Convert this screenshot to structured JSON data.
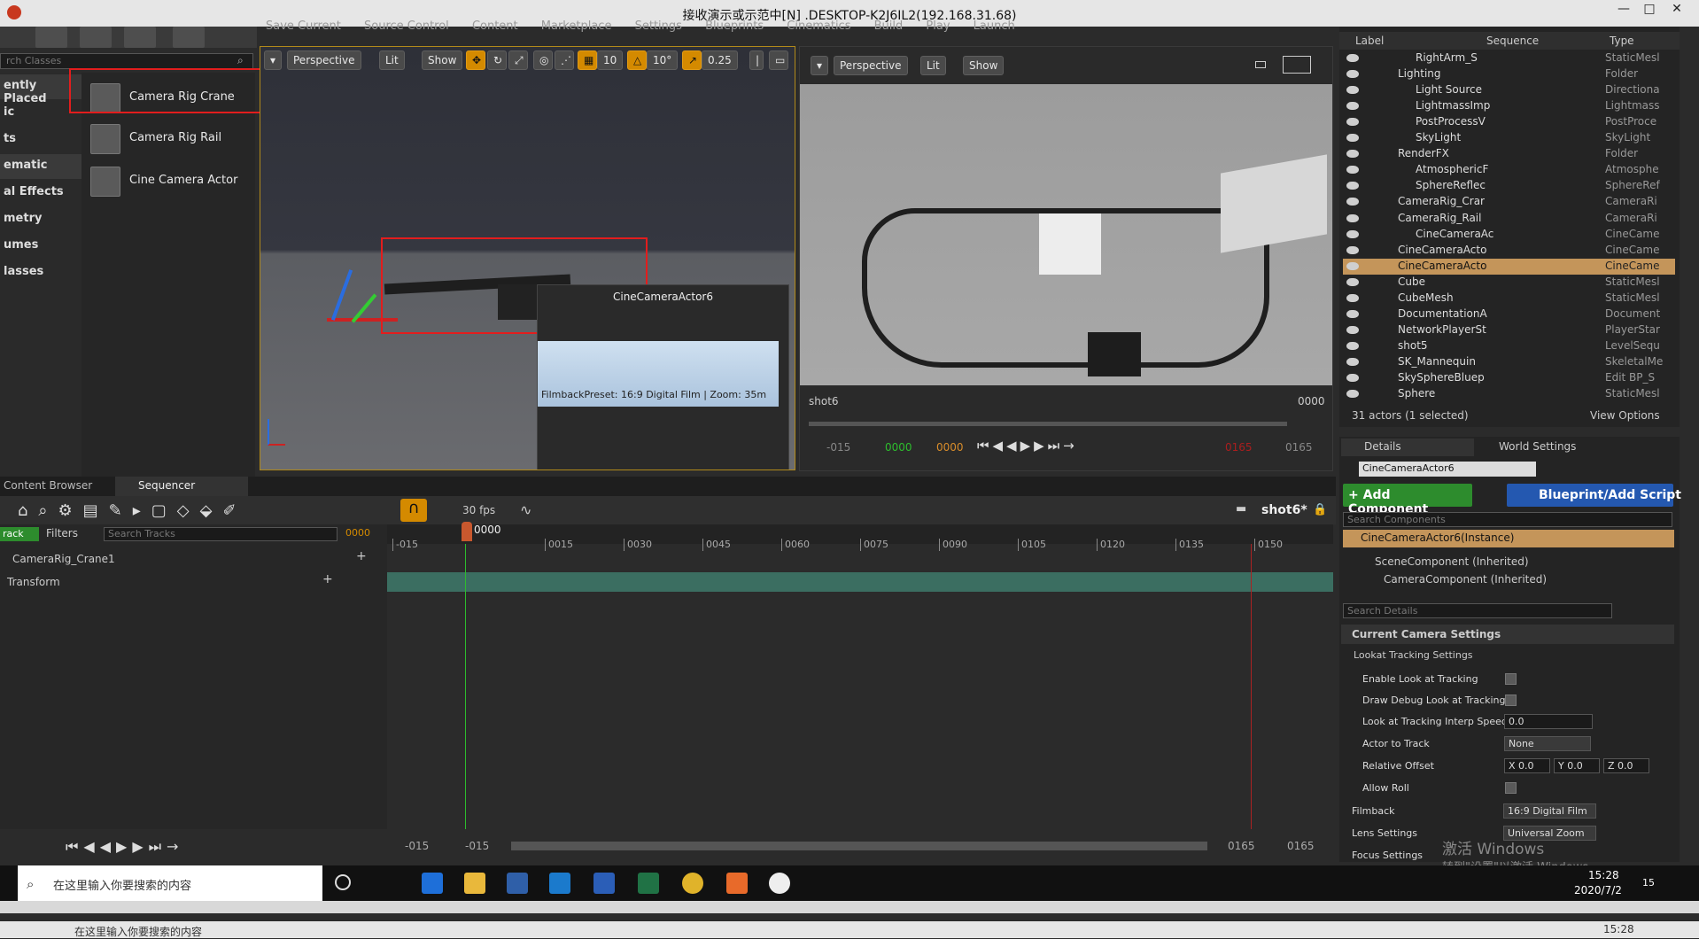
{
  "window": {
    "title": "接收演示或示范中[N] .DESKTOP-K2J6IL2(192.168.31.68)"
  },
  "menu": [
    "Save Current",
    "Source Control",
    "Content",
    "Marketplace",
    "Settings",
    "Blueprints",
    "Cinematics",
    "Build",
    "Play",
    "Launch"
  ],
  "place": {
    "search_placeholder": "rch Classes",
    "categories": [
      "ently Placed",
      "ic",
      "ts",
      "ematic",
      "al Effects",
      "metry",
      "umes",
      "lasses"
    ],
    "items": [
      "Camera Rig Crane",
      "Camera Rig Rail",
      "Cine Camera Actor"
    ]
  },
  "viewport_left": {
    "perspective": "Perspective",
    "lit": "Lit",
    "show": "Show",
    "grid_snap": "10",
    "rot_snap": "10°",
    "scale_snap": "0.25",
    "actor_label": "CineCameraActor6",
    "pip_caption": "FilmbackPreset: 16:9 Digital Film | Zoom: 35m"
  },
  "viewport_right": {
    "perspective": "Perspective",
    "lit": "Lit",
    "show": "Show",
    "shot": "shot6",
    "frame": "0000",
    "times": [
      "-015",
      "0000",
      "0000",
      "0165"
    ],
    "end_red": "0165"
  },
  "content_tabs": [
    "Content Browser",
    "Sequencer"
  ],
  "sequencer": {
    "fps": "30 fps",
    "shot": "shot6*",
    "search_placeholder": "Search Tracks",
    "time": "0000",
    "track_btn": "rack",
    "filters": "Filters",
    "tracks": [
      "CameraRig_Crane1",
      "Transform"
    ],
    "playhead": "0000",
    "ticks": [
      "-015",
      "0015",
      "0030",
      "0045",
      "0060",
      "0075",
      "0090",
      "0105",
      "0120",
      "0135",
      "0150"
    ],
    "range": [
      "-015",
      "-015",
      "0165",
      "0165"
    ]
  },
  "outliner": {
    "headers": [
      "Label",
      "Sequence",
      "Type"
    ],
    "rows": [
      {
        "name": "RightArm_S",
        "type": "StaticMesl"
      },
      {
        "name": "Lighting",
        "type": "Folder"
      },
      {
        "name": "Light Source",
        "type": "Directiona"
      },
      {
        "name": "LightmassImp",
        "type": "Lightmass"
      },
      {
        "name": "PostProcessV",
        "type": "PostProce"
      },
      {
        "name": "SkyLight",
        "type": "SkyLight"
      },
      {
        "name": "RenderFX",
        "type": "Folder"
      },
      {
        "name": "AtmosphericF",
        "type": "Atmosphe"
      },
      {
        "name": "SphereReflec",
        "type": "SphereRef"
      },
      {
        "name": "CameraRig_Crar",
        "type": "CameraRi"
      },
      {
        "name": "CameraRig_Rail",
        "type": "CameraRi"
      },
      {
        "name": "CineCameraAc",
        "type": "CineCame"
      },
      {
        "name": "CineCameraActo",
        "type": "CineCame"
      },
      {
        "name": "CineCameraActo",
        "type": "CineCame"
      },
      {
        "name": "Cube",
        "type": "StaticMesl"
      },
      {
        "name": "CubeMesh",
        "type": "StaticMesl"
      },
      {
        "name": "DocumentationA",
        "type": "Document"
      },
      {
        "name": "NetworkPlayerSt",
        "type": "PlayerStar"
      },
      {
        "name": "shot5",
        "type": "LevelSequ"
      },
      {
        "name": "SK_Mannequin",
        "type": "SkeletalMe"
      },
      {
        "name": "SkySphereBluep",
        "type": "Edit BP_S"
      },
      {
        "name": "Sphere",
        "type": "StaticMesl"
      }
    ],
    "status": "31 actors (1 selected)",
    "view_options": "View Options"
  },
  "details": {
    "tabs": [
      "Details",
      "World Settings"
    ],
    "actor_name": "CineCameraActor6",
    "add_component": "+ Add Component",
    "blueprint": "Blueprint/Add Script",
    "search_components": "Search Components",
    "instance": "CineCameraActor6(Instance)",
    "components": [
      "SceneComponent (Inherited)",
      "CameraComponent (Inherited)"
    ],
    "search_details": "Search Details",
    "section": "Current Camera Settings",
    "subsection": "Lookat Tracking Settings",
    "props": [
      {
        "label": "Enable Look at Tracking",
        "kind": "check"
      },
      {
        "label": "Draw Debug Look at Tracking P",
        "kind": "check"
      },
      {
        "label": "Look at Tracking Interp Speed",
        "kind": "value",
        "value": "0.0"
      },
      {
        "label": "Actor to Track",
        "kind": "combo",
        "value": "None"
      },
      {
        "label": "Relative Offset",
        "kind": "xyz",
        "x": "X 0.0",
        "y": "Y 0.0",
        "z": "Z 0.0"
      },
      {
        "label": "Allow Roll",
        "kind": "check"
      }
    ],
    "filmback_label": "Filmback",
    "filmback_value": "16:9 Digital Film",
    "lens_label": "Lens Settings",
    "lens_value": "Universal Zoom",
    "focus_label": "Focus Settings"
  },
  "watermark": {
    "line1": "激活 Windows",
    "line2": "转到\"设置\"以激活 Windows。"
  },
  "taskbar": {
    "search": "在这里输入你要搜索的内容",
    "time": "15:28",
    "date": "2020/7/2",
    "notif": "15"
  },
  "bottom": {
    "search": "在这里输入你要搜索的内容",
    "time": "15:28"
  }
}
